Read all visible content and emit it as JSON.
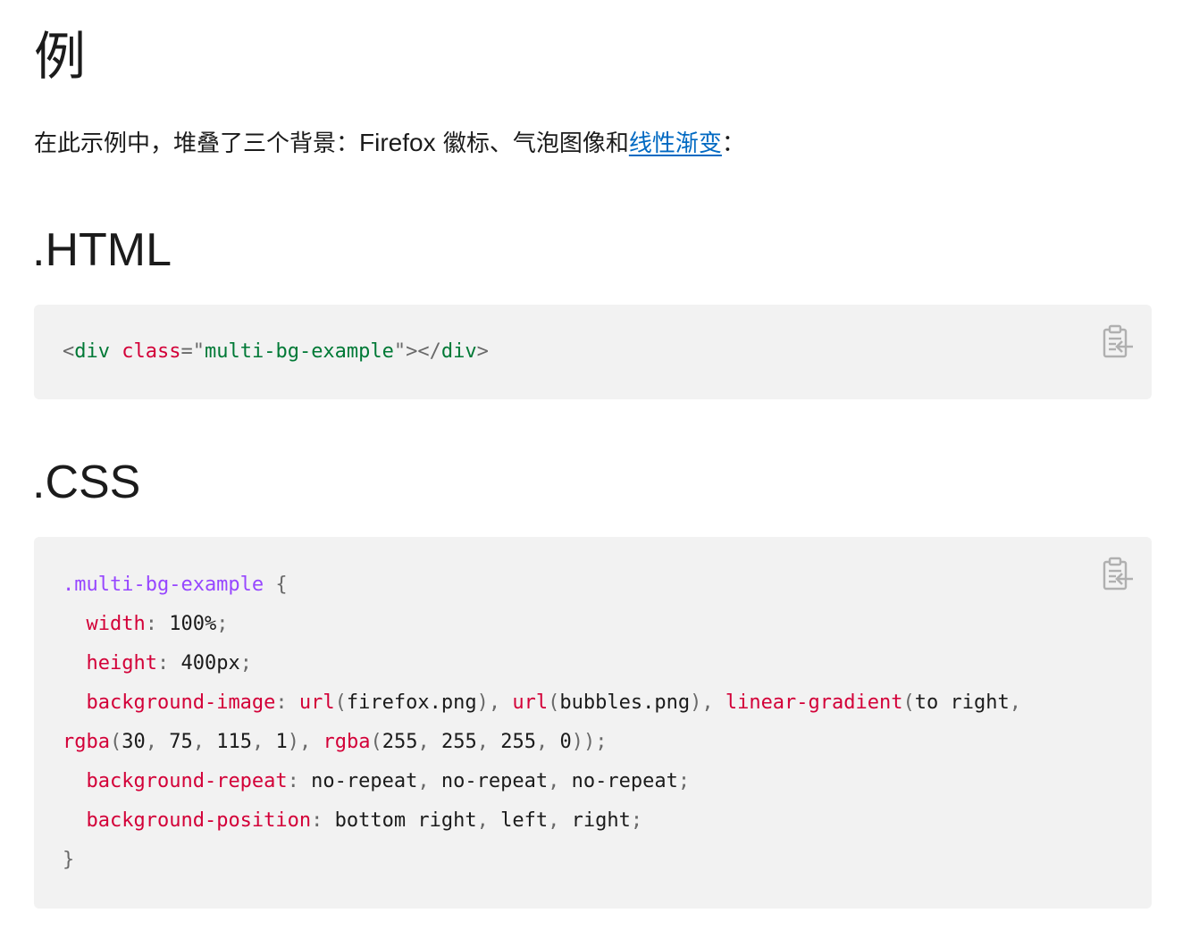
{
  "heading": "例",
  "intro": {
    "before": "在此示例中，堆叠了三个背景：",
    "latin": "Firefox",
    "middle": " 徽标、气泡图像和",
    "link": "线性渐变",
    "after": "："
  },
  "html_section": {
    "title": ".HTML",
    "code": {
      "lt1": "<",
      "tag_open": "div",
      "attr": "class",
      "eq": "=",
      "q1": "\"",
      "value": "multi-bg-example",
      "q2": "\"",
      "gt_lt": "></",
      "tag_close": "div",
      "gt": ">"
    }
  },
  "css_section": {
    "title": ".CSS",
    "code": {
      "selector": ".multi-bg-example",
      "brace_open": "{",
      "brace_close": "}",
      "width_prop": "width",
      "width_val": "100%",
      "height_prop": "height",
      "height_val": "400px",
      "bgimage_prop": "background-image",
      "url1_fn": "url",
      "url1_arg": "firefox.png",
      "url2_fn": "url",
      "url2_arg": "bubbles.png",
      "lg_fn": "linear-gradient",
      "lg_dir": "to right",
      "rgba1_fn": "rgba",
      "rgba1_a": "30",
      "rgba1_b": "75",
      "rgba1_c": "115",
      "rgba1_d": "1",
      "rgba2_fn": "rgba",
      "rgba2_a": "255",
      "rgba2_b": "255",
      "rgba2_c": "255",
      "rgba2_d": "0",
      "repeat_prop": "background-repeat",
      "repeat_v1": "no-repeat",
      "repeat_v2": "no-repeat",
      "repeat_v3": "no-repeat",
      "position_prop": "background-position",
      "position_v1": "bottom right",
      "position_v2": "left",
      "position_v3": "right"
    }
  },
  "icons": {
    "copy": "clipboard-copy-icon"
  },
  "colors": {
    "link": "#0069c2",
    "code_bg": "#f2f2f2",
    "tag": "#007936",
    "attr": "#d30038",
    "selector": "#9747ff",
    "punct": "#696969"
  }
}
